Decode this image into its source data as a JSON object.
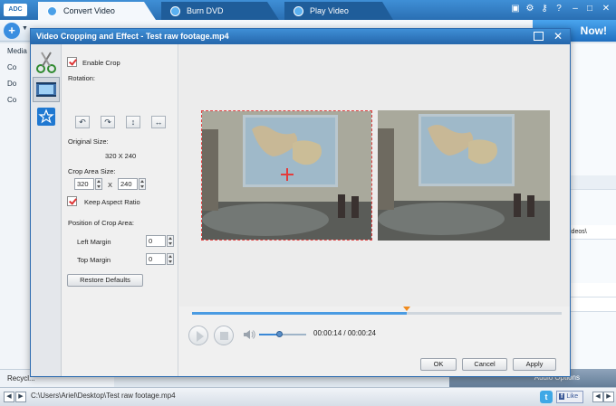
{
  "app": {
    "logo": "ADC",
    "tabs": [
      {
        "label": "Convert Video"
      },
      {
        "label": "Burn DVD"
      },
      {
        "label": "Play Video"
      }
    ],
    "convert_now_label": "Now!",
    "left_panel": {
      "header": "Media",
      "items": [
        "Co",
        "Do",
        "Co"
      ],
      "recycle": "Recycl..."
    },
    "right_panel": {
      "path_fragment": "ideos\\"
    },
    "audio_options_label": "Audio Options",
    "status_path": "C:\\Users\\Ariel\\Desktop\\Test raw footage.mp4",
    "like_label": "Like"
  },
  "dialog": {
    "title": "Video Cropping and Effect - Test raw footage.mp4",
    "enable_crop_label": "Enable Crop",
    "enable_crop_checked": true,
    "rotation_label": "Rotation:",
    "rotation_buttons": [
      "rotate-left",
      "rotate-right",
      "flip-vertical",
      "flip-horizontal"
    ],
    "original_size_label": "Original Size:",
    "original_size_value": "320 X 240",
    "crop_area_size_label": "Crop Area Size:",
    "crop_width": "320",
    "crop_x_label": "X",
    "crop_height": "240",
    "keep_aspect_label": "Keep Aspect Ratio",
    "keep_aspect_checked": true,
    "position_label": "Position of Crop Area:",
    "left_margin_label": "Left Margin",
    "left_margin_value": "0",
    "top_margin_label": "Top Margin",
    "top_margin_value": "0",
    "restore_defaults_label": "Restore Defaults",
    "playback": {
      "current_time": "00:00:14",
      "separator": "/",
      "total_time": "00:00:24",
      "progress": 0.58,
      "volume": 0.45
    },
    "ok_label": "OK",
    "cancel_label": "Cancel",
    "apply_label": "Apply"
  }
}
